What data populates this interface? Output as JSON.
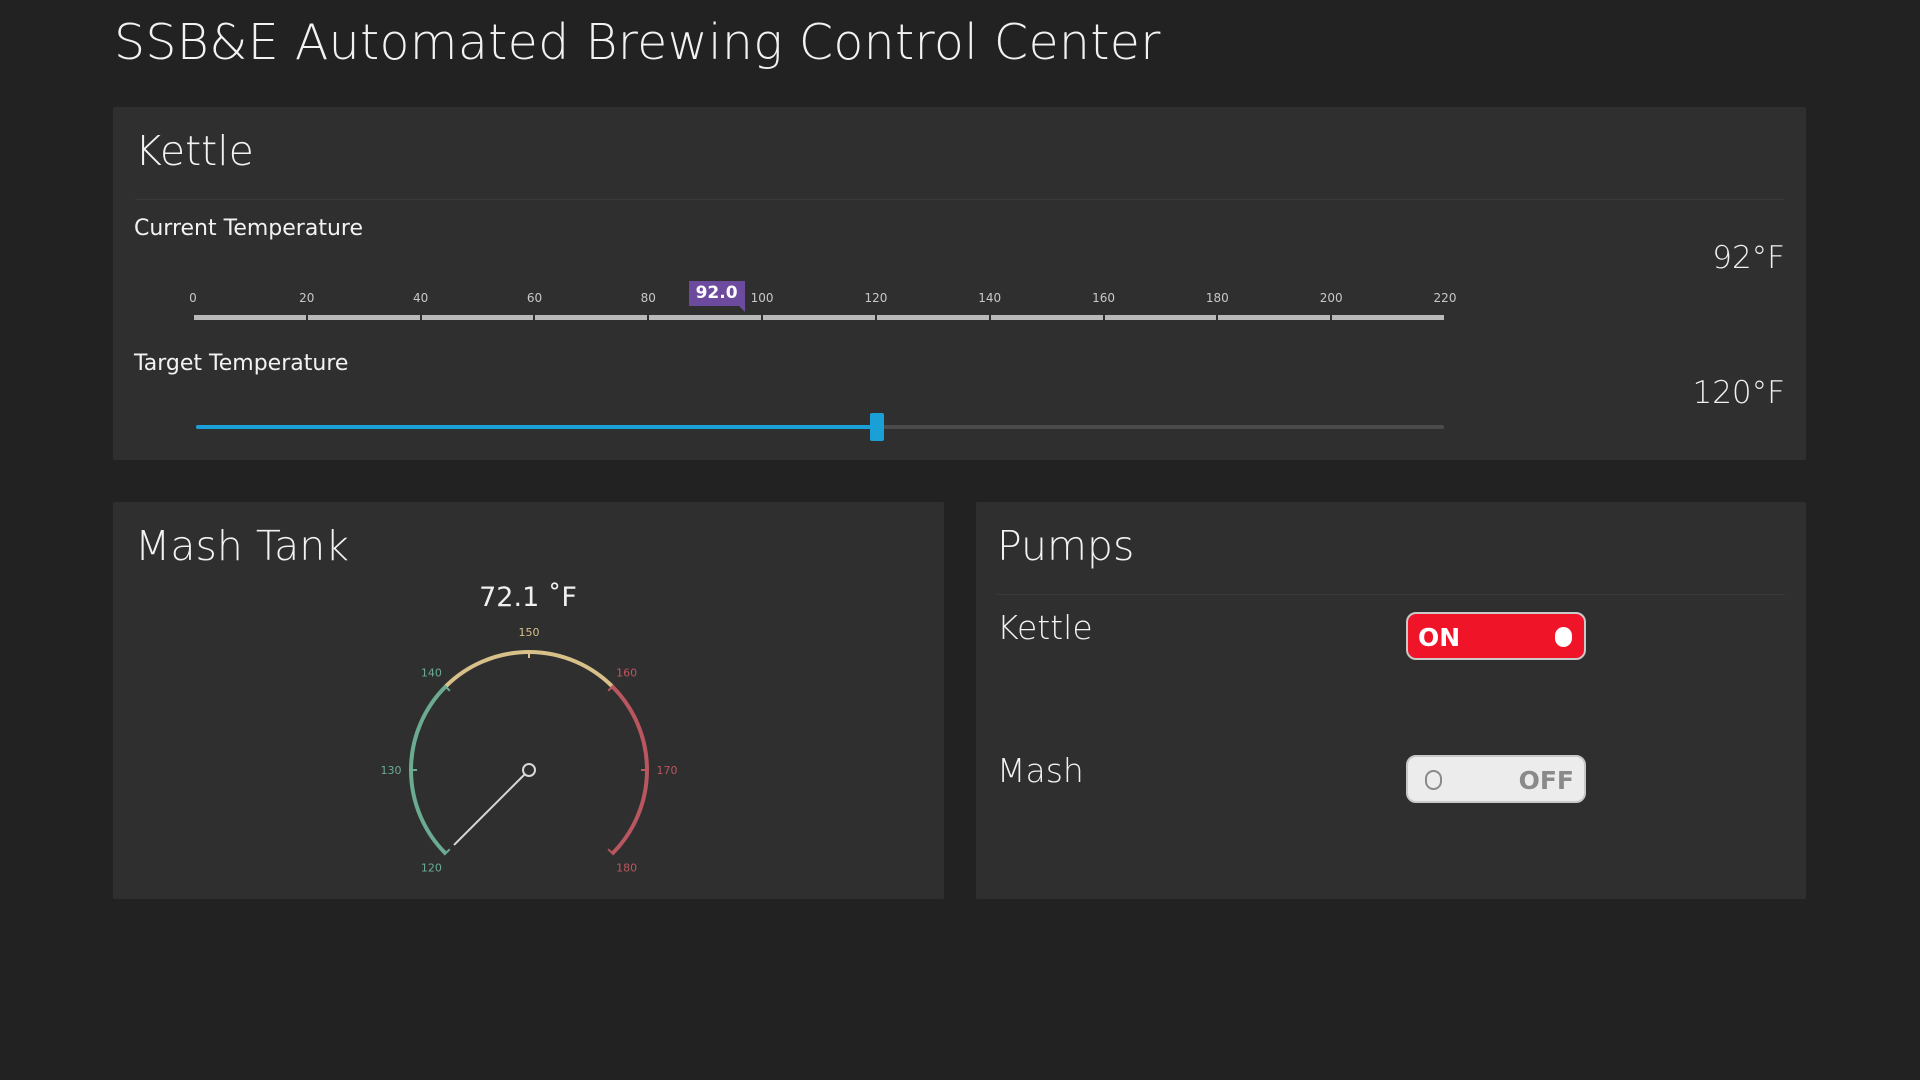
{
  "app": {
    "title": "SSB&E Automated Brewing Control Center"
  },
  "kettle": {
    "title": "Kettle",
    "current": {
      "label": "Current Temperature",
      "value_text": "92°F",
      "marker_text": "92.0",
      "value": 92,
      "min": 0,
      "max": 220,
      "ticks": [
        "0",
        "20",
        "40",
        "60",
        "80",
        "100",
        "120",
        "140",
        "160",
        "180",
        "200",
        "220"
      ]
    },
    "target": {
      "label": "Target Temperature",
      "value_text": "120°F",
      "value": 120,
      "min": 0,
      "max": 220
    }
  },
  "mash": {
    "title": "Mash Tank",
    "gauge": {
      "readout": "72.1 ˚F",
      "value": 72.1,
      "min": 120,
      "max": 180,
      "ticks": [
        "120",
        "130",
        "140",
        "150",
        "160",
        "170",
        "180"
      ],
      "bands": [
        {
          "from": 120,
          "to": 140,
          "color": "#6aab92"
        },
        {
          "from": 140,
          "to": 160,
          "color": "#d8c08a"
        },
        {
          "from": 160,
          "to": 180,
          "color": "#b9565f"
        }
      ]
    }
  },
  "pumps": {
    "title": "Pumps",
    "items": [
      {
        "label": "Kettle",
        "state": "ON",
        "on": true
      },
      {
        "label": "Mash",
        "state": "OFF",
        "on": false
      }
    ]
  },
  "colors": {
    "background": "#222222",
    "panel": "#2f2f2f",
    "accent": "#1aa0d6",
    "marker": "#6c4b9e",
    "toggle_on": "#f01428",
    "toggle_off": "#ececec"
  }
}
